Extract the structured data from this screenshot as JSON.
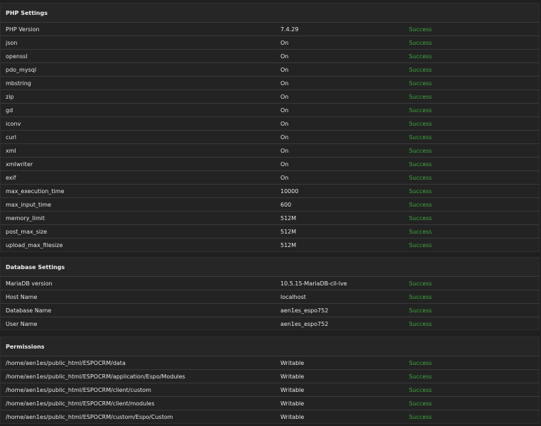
{
  "php": {
    "title": "PHP Settings",
    "rows": [
      {
        "name": "PHP Version",
        "value": "7.4.29",
        "status": "Success"
      },
      {
        "name": "json",
        "value": "On",
        "status": "Success"
      },
      {
        "name": "openssl",
        "value": "On",
        "status": "Success"
      },
      {
        "name": "pdo_mysql",
        "value": "On",
        "status": "Success"
      },
      {
        "name": "mbstring",
        "value": "On",
        "status": "Success"
      },
      {
        "name": "zip",
        "value": "On",
        "status": "Success"
      },
      {
        "name": "gd",
        "value": "On",
        "status": "Success"
      },
      {
        "name": "iconv",
        "value": "On",
        "status": "Success"
      },
      {
        "name": "curl",
        "value": "On",
        "status": "Success"
      },
      {
        "name": "xml",
        "value": "On",
        "status": "Success"
      },
      {
        "name": "xmlwriter",
        "value": "On",
        "status": "Success"
      },
      {
        "name": "exif",
        "value": "On",
        "status": "Success"
      },
      {
        "name": "max_execution_time",
        "value": "10000",
        "status": "Success"
      },
      {
        "name": "max_input_time",
        "value": "600",
        "status": "Success"
      },
      {
        "name": "memory_limit",
        "value": "512M",
        "status": "Success"
      },
      {
        "name": "post_max_size",
        "value": "512M",
        "status": "Success"
      },
      {
        "name": "upload_max_filesize",
        "value": "512M",
        "status": "Success"
      }
    ]
  },
  "database": {
    "title": "Database Settings",
    "rows": [
      {
        "name": "MariaDB version",
        "value": "10.5.15-MariaDB-cll-lve",
        "status": "Success"
      },
      {
        "name": "Host Name",
        "value": "localhost",
        "status": "Success"
      },
      {
        "name": "Database Name",
        "value": "aen1es_espo752",
        "status": "Success"
      },
      {
        "name": "User Name",
        "value": "aen1es_espo752",
        "status": "Success"
      }
    ]
  },
  "permissions": {
    "title": "Permissions",
    "rows": [
      {
        "name": "/home/aen1es/public_html/ESPOCRM/data",
        "value": "Writable",
        "status": "Success"
      },
      {
        "name": "/home/aen1es/public_html/ESPOCRM/application/Espo/Modules",
        "value": "Writable",
        "status": "Success"
      },
      {
        "name": "/home/aen1es/public_html/ESPOCRM/client/custom",
        "value": "Writable",
        "status": "Success"
      },
      {
        "name": "/home/aen1es/public_html/ESPOCRM/client/modules",
        "value": "Writable",
        "status": "Success"
      },
      {
        "name": "/home/aen1es/public_html/ESPOCRM/custom/Espo/Custom",
        "value": "Writable",
        "status": "Success"
      }
    ]
  },
  "colors": {
    "background": "#1f1f1f",
    "panel": "#232323",
    "divider": "#3a3a3a",
    "text": "#e6e6e6",
    "success": "#3ea83e"
  }
}
